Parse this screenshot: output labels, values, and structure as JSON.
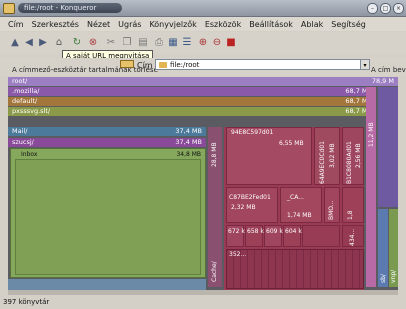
{
  "window": {
    "title": "file:/root - Konqueror"
  },
  "menubar": [
    "Cím",
    "Szerkesztés",
    "Nézet",
    "Ugrás",
    "Könyvjelzők",
    "Eszközök",
    "Beállítások",
    "Ablak",
    "Segítség"
  ],
  "toolbar": {
    "tooltip": "A saját URL megnyitása"
  },
  "locationbar": {
    "clear_text": "A címmező-eszköztár tartalmának törlése",
    "label": "Cím",
    "value": "file:/root",
    "right_text": "A cím bevit"
  },
  "treemap": {
    "rows": [
      {
        "name": "root/",
        "size": "78,9 M"
      },
      {
        "name": ".mozilla/",
        "size": "68,7 MB"
      },
      {
        "name": "default/",
        "size": "68,7 MB"
      },
      {
        "name": "pxsssvg.slt/",
        "size": "68,7 MB"
      },
      {
        "name": "Mail/",
        "size": "37,4 MB"
      },
      {
        "name": "szucsj/",
        "size": "37,4 MB"
      }
    ],
    "inbox": {
      "name": "Inbox",
      "size": "34,8 MB"
    },
    "cache": {
      "name": "Cache/",
      "size": "28,8 MB"
    },
    "tile1": {
      "name": "94E8C597d01",
      "size": "6,55 MB"
    },
    "tile2": {
      "name": "64A9EC0Cd01",
      "size": "3,02 MB"
    },
    "tile3": {
      "name": "B1C8080Ad01",
      "size": "2,56 MB"
    },
    "tile4": {
      "name": "C87BE2Fed01",
      "size": "2,32 MB"
    },
    "tile5": {
      "name": "_CA...",
      "size": "1,74 MB"
    },
    "tile6": {
      "name": "BMO...",
      "size": "1,8"
    },
    "small_sizes": [
      "672 k",
      "658 k",
      "609 k",
      "604 k",
      "434...",
      "352..."
    ],
    "right_col": {
      "label": "11,2 MB"
    },
    "right_small": [
      "sb/",
      "vnp/",
      "kd/"
    ]
  },
  "statusbar": {
    "text": "397 könyvtár"
  }
}
